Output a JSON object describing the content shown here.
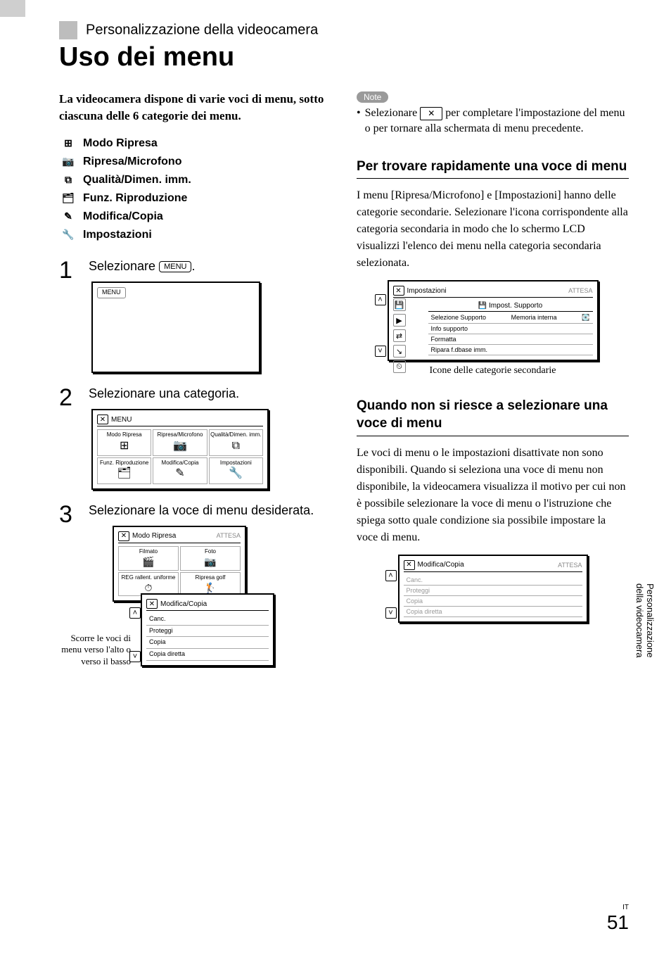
{
  "section_label": "Personalizzazione della videocamera",
  "main_title": "Uso dei menu",
  "intro": "La videocamera dispone di varie voci di menu, sotto ciascuna delle 6 categorie dei menu.",
  "categories": [
    {
      "icon": "⊞",
      "label": "Modo Ripresa"
    },
    {
      "icon": "📷",
      "label": "Ripresa/Microfono"
    },
    {
      "icon": "⧉",
      "label": "Qualità/Dimen. imm."
    },
    {
      "icon": "🗂",
      "label": "Funz. Riproduzione"
    },
    {
      "icon": "✎",
      "label": "Modifica/Copia"
    },
    {
      "icon": "🔧",
      "label": "Impostazioni"
    }
  ],
  "steps": {
    "s1": {
      "num": "1",
      "text_before": "Selezionare ",
      "pill": "MENU",
      "text_after": ".",
      "screen_pill": "MENU"
    },
    "s2": {
      "num": "2",
      "text": "Selezionare una categoria.",
      "header_pill": "MENU",
      "cells": [
        "Modo Ripresa",
        "Ripresa/Microfono",
        "Qualità/Dimen. imm.",
        "Funz. Riproduzione",
        "Modifica/Copia",
        "Impostazioni"
      ]
    },
    "s3": {
      "num": "3",
      "text": "Selezionare la voce di menu desiderata.",
      "screen_a": {
        "header": "Modo Ripresa",
        "status": "ATTESA",
        "cells": [
          "Filmato",
          "Foto",
          "REG rallent. uniforme",
          "Ripresa golf"
        ]
      },
      "screen_b": {
        "header": "Modifica/Copia",
        "rows": [
          "Canc.",
          "Proteggi",
          "Copia",
          "Copia diretta"
        ]
      },
      "annotation": "Scorre le voci di menu verso l'alto o verso il basso"
    }
  },
  "right": {
    "note_label": "Note",
    "note_text_before": "Selezionare ",
    "note_x": "✕",
    "note_text_after": " per completare l'impostazione del menu o per tornare alla schermata di menu precedente.",
    "sub1_heading": "Per trovare rapidamente una voce di menu",
    "sub1_body": "I menu [Ripresa/Microfono] e [Impostazioni] hanno delle categorie secondarie. Selezionare l'icona corrispondente alla categoria secondaria in modo che lo schermo LCD visualizzi l'elenco dei menu nella categoria secondaria selezionata.",
    "screen_r1": {
      "header": "Impostazioni",
      "status": "ATTESA",
      "subheader": "Impost. Supporto",
      "rows": [
        {
          "l": "Selezione Supporto",
          "r": "Memoria interna"
        },
        {
          "l": "Info supporto",
          "r": ""
        },
        {
          "l": "Formatta",
          "r": ""
        },
        {
          "l": "Ripara f.dbase imm.",
          "r": ""
        }
      ]
    },
    "caption_r1": "Icone delle categorie secondarie",
    "sub2_heading": "Quando non si riesce a selezionare una voce di menu",
    "sub2_body": "Le voci di menu o le impostazioni disattivate non sono disponibili. Quando si seleziona una voce di menu non disponibile, la videocamera visualizza il motivo per cui non è possibile selezionare la voce di menu o l'istruzione che spiega sotto quale condizione sia possibile impostare la voce di menu.",
    "screen_r2": {
      "header": "Modifica/Copia",
      "status": "ATTESA",
      "rows": [
        "Canc.",
        "Proteggi",
        "Copia",
        "Copia diretta"
      ]
    }
  },
  "side_tab": "Personalizzazione della videocamera",
  "footer": {
    "lang": "IT",
    "page": "51"
  }
}
